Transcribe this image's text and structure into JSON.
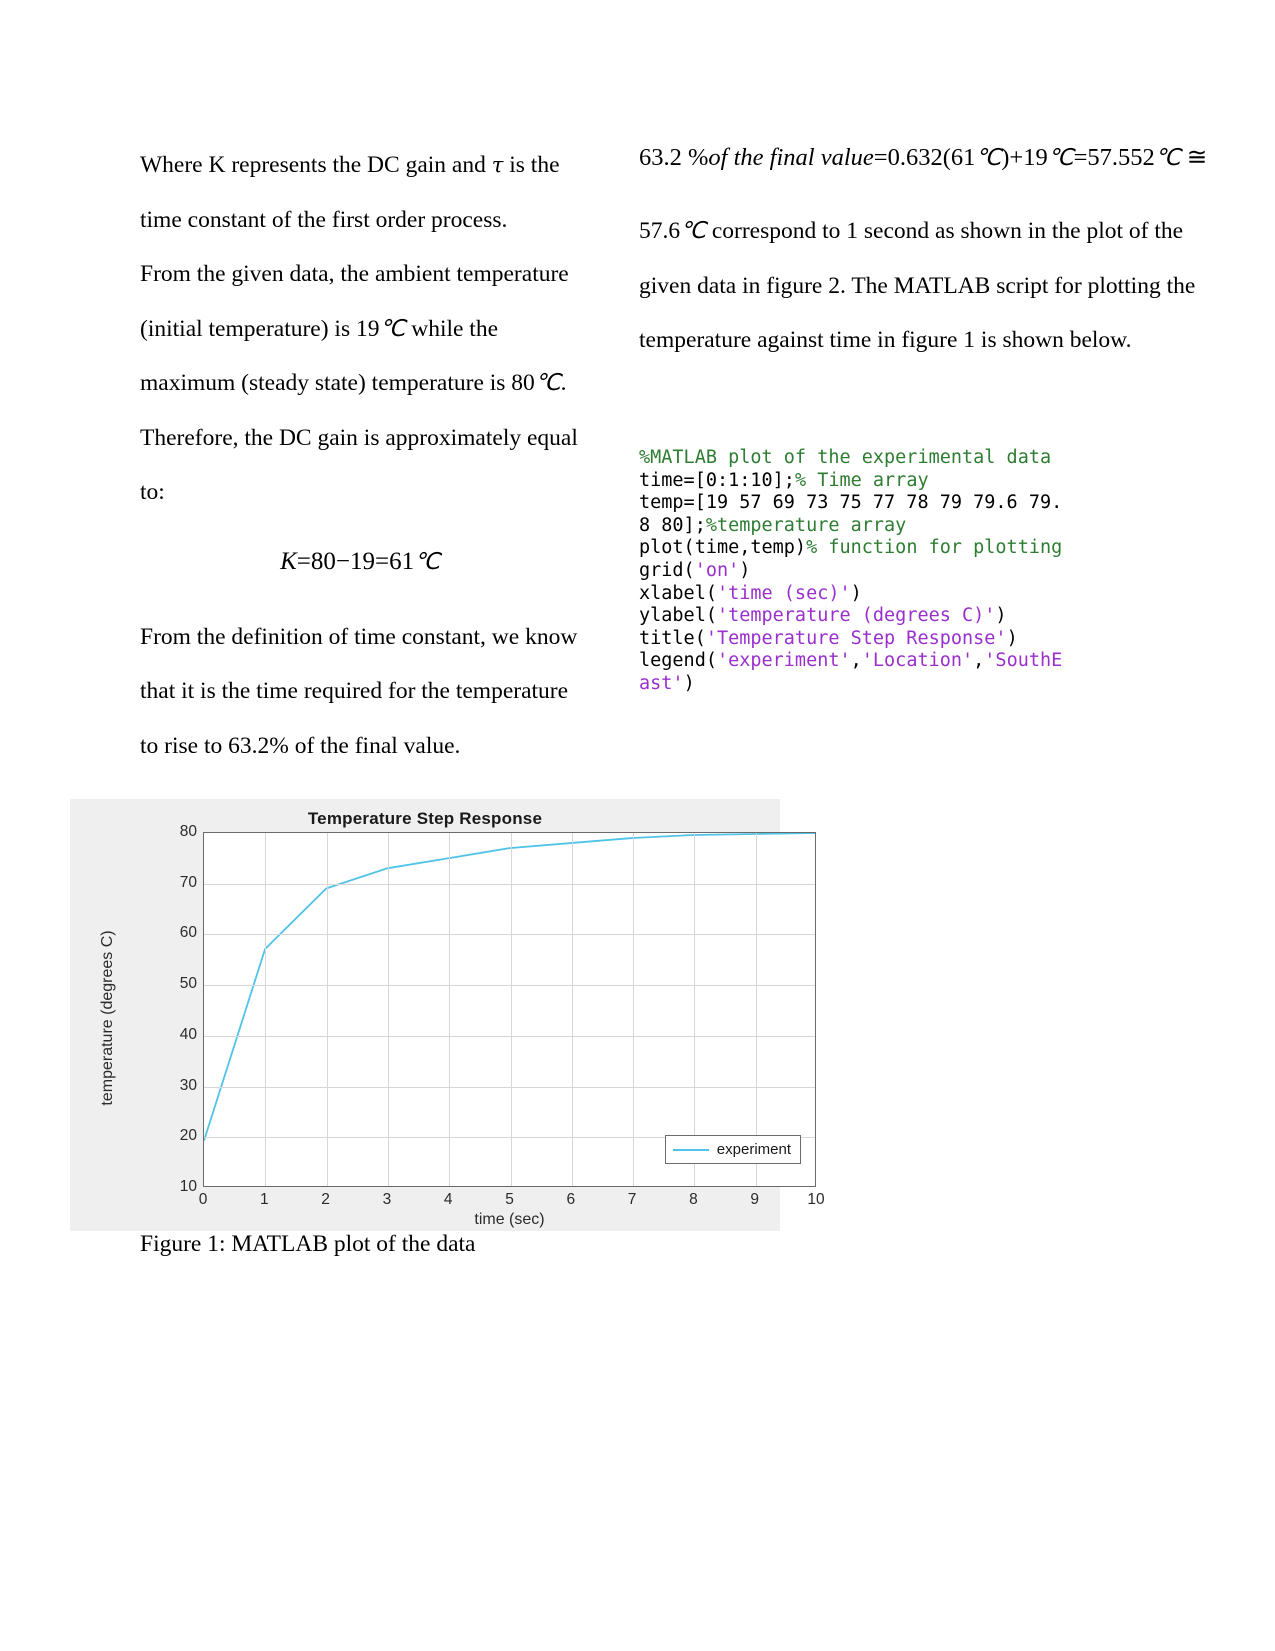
{
  "document": {
    "left_column": {
      "paragraph_1_part_a": "Where K represents the DC gain and ",
      "tau_symbol": "τ",
      "paragraph_1_part_b": " is the time constant of the first order process.",
      "paragraph_2_part_a": "From the given data, the ambient temperature (initial temperature) is 19",
      "degc_1": "℃",
      "paragraph_2_part_b": " while the maximum (steady state) temperature is 80",
      "degc_2": "℃",
      "paragraph_2_part_c": ". Therefore, the DC gain is approximately equal to:",
      "equation_k": {
        "var": "K",
        "expression": "=80−19=61",
        "unit": "℃"
      },
      "paragraph_3": "From the definition of time constant, we know that it is the time required for the temperature to rise to 63.2% of the final value."
    },
    "right_column": {
      "equation_final_value": {
        "lead": "63.2 %",
        "italic_phrase": "of the final value",
        "expression_a": "=0.632",
        "paren_open": "(",
        "inner": "61",
        "unit_1": "℃",
        "paren_close": ")",
        "expression_b": "+19",
        "unit_2": "℃",
        "expression_c": "=57.552",
        "unit_3": "℃",
        "approx": "≅"
      },
      "paragraph_1_value": "57.6",
      "paragraph_1_unit": "℃",
      "paragraph_1_text": " correspond to 1 second as shown in the plot of the given data in figure 2. The MATLAB script for plotting the temperature against time in figure 1 is shown below."
    },
    "code_block": {
      "language": "matlab",
      "lines": [
        {
          "segments": [
            {
              "text": "%MATLAB plot of the experimental data",
              "style": "comment"
            }
          ]
        },
        {
          "segments": [
            {
              "text": "time=[0:1:10];",
              "style": "plain"
            },
            {
              "text": "% Time array",
              "style": "comment"
            }
          ]
        },
        {
          "segments": [
            {
              "text": "temp=[19 57 69 73 75 77 78 79 79.6 79.8 80];",
              "style": "plain"
            },
            {
              "text": "%temperature array",
              "style": "comment"
            }
          ]
        },
        {
          "segments": [
            {
              "text": "plot(time,temp)",
              "style": "plain"
            },
            {
              "text": "% function for plotting",
              "style": "comment"
            }
          ]
        },
        {
          "segments": [
            {
              "text": "grid(",
              "style": "plain"
            },
            {
              "text": "'on'",
              "style": "string"
            },
            {
              "text": ")",
              "style": "plain"
            }
          ]
        },
        {
          "segments": [
            {
              "text": "xlabel(",
              "style": "plain"
            },
            {
              "text": "'time (sec)'",
              "style": "string"
            },
            {
              "text": ")",
              "style": "plain"
            }
          ]
        },
        {
          "segments": [
            {
              "text": "ylabel(",
              "style": "plain"
            },
            {
              "text": "'temperature (degrees C)'",
              "style": "string"
            },
            {
              "text": ")",
              "style": "plain"
            }
          ]
        },
        {
          "segments": [
            {
              "text": "title(",
              "style": "plain"
            },
            {
              "text": "'Temperature Step Response'",
              "style": "string"
            },
            {
              "text": ")",
              "style": "plain"
            }
          ]
        },
        {
          "segments": [
            {
              "text": "legend(",
              "style": "plain"
            },
            {
              "text": "'experiment'",
              "style": "string"
            },
            {
              "text": ",",
              "style": "plain"
            },
            {
              "text": "'Location'",
              "style": "string"
            },
            {
              "text": ",",
              "style": "plain"
            },
            {
              "text": "'SouthEast'",
              "style": "string"
            },
            {
              "text": ")",
              "style": "plain"
            }
          ]
        }
      ]
    },
    "figure_caption": "Figure 1: MATLAB plot of the data"
  },
  "chart_data": {
    "type": "line",
    "title": "Temperature Step Response",
    "xlabel": "time (sec)",
    "ylabel": "temperature (degrees C)",
    "x": [
      0,
      1,
      2,
      3,
      4,
      5,
      6,
      7,
      8,
      9,
      10
    ],
    "series": [
      {
        "name": "experiment",
        "values": [
          19,
          57,
          69,
          73,
          75,
          77,
          78,
          79,
          79.6,
          79.8,
          80
        ],
        "color": "#4fc3e8"
      }
    ],
    "xlim": [
      0,
      10
    ],
    "ylim": [
      10,
      80
    ],
    "xticks": [
      0,
      1,
      2,
      3,
      4,
      5,
      6,
      7,
      8,
      9,
      10
    ],
    "yticks": [
      10,
      20,
      30,
      40,
      50,
      60,
      70,
      80
    ],
    "grid": true,
    "legend_position": "SouthEast",
    "legend_entries": [
      "experiment"
    ],
    "background": "#efefef",
    "plot_background": "#ffffff"
  }
}
